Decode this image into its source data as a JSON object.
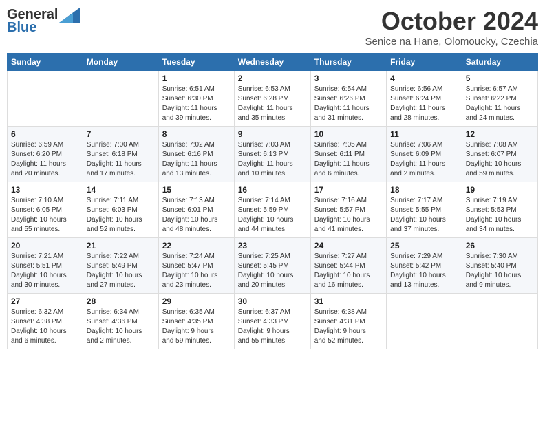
{
  "header": {
    "logo_general": "General",
    "logo_blue": "Blue",
    "title": "October 2024",
    "location": "Senice na Hane, Olomoucky, Czechia"
  },
  "weekdays": [
    "Sunday",
    "Monday",
    "Tuesday",
    "Wednesday",
    "Thursday",
    "Friday",
    "Saturday"
  ],
  "weeks": [
    [
      {
        "day": "",
        "detail": ""
      },
      {
        "day": "",
        "detail": ""
      },
      {
        "day": "1",
        "detail": "Sunrise: 6:51 AM\nSunset: 6:30 PM\nDaylight: 11 hours\nand 39 minutes."
      },
      {
        "day": "2",
        "detail": "Sunrise: 6:53 AM\nSunset: 6:28 PM\nDaylight: 11 hours\nand 35 minutes."
      },
      {
        "day": "3",
        "detail": "Sunrise: 6:54 AM\nSunset: 6:26 PM\nDaylight: 11 hours\nand 31 minutes."
      },
      {
        "day": "4",
        "detail": "Sunrise: 6:56 AM\nSunset: 6:24 PM\nDaylight: 11 hours\nand 28 minutes."
      },
      {
        "day": "5",
        "detail": "Sunrise: 6:57 AM\nSunset: 6:22 PM\nDaylight: 11 hours\nand 24 minutes."
      }
    ],
    [
      {
        "day": "6",
        "detail": "Sunrise: 6:59 AM\nSunset: 6:20 PM\nDaylight: 11 hours\nand 20 minutes."
      },
      {
        "day": "7",
        "detail": "Sunrise: 7:00 AM\nSunset: 6:18 PM\nDaylight: 11 hours\nand 17 minutes."
      },
      {
        "day": "8",
        "detail": "Sunrise: 7:02 AM\nSunset: 6:16 PM\nDaylight: 11 hours\nand 13 minutes."
      },
      {
        "day": "9",
        "detail": "Sunrise: 7:03 AM\nSunset: 6:13 PM\nDaylight: 11 hours\nand 10 minutes."
      },
      {
        "day": "10",
        "detail": "Sunrise: 7:05 AM\nSunset: 6:11 PM\nDaylight: 11 hours\nand 6 minutes."
      },
      {
        "day": "11",
        "detail": "Sunrise: 7:06 AM\nSunset: 6:09 PM\nDaylight: 11 hours\nand 2 minutes."
      },
      {
        "day": "12",
        "detail": "Sunrise: 7:08 AM\nSunset: 6:07 PM\nDaylight: 10 hours\nand 59 minutes."
      }
    ],
    [
      {
        "day": "13",
        "detail": "Sunrise: 7:10 AM\nSunset: 6:05 PM\nDaylight: 10 hours\nand 55 minutes."
      },
      {
        "day": "14",
        "detail": "Sunrise: 7:11 AM\nSunset: 6:03 PM\nDaylight: 10 hours\nand 52 minutes."
      },
      {
        "day": "15",
        "detail": "Sunrise: 7:13 AM\nSunset: 6:01 PM\nDaylight: 10 hours\nand 48 minutes."
      },
      {
        "day": "16",
        "detail": "Sunrise: 7:14 AM\nSunset: 5:59 PM\nDaylight: 10 hours\nand 44 minutes."
      },
      {
        "day": "17",
        "detail": "Sunrise: 7:16 AM\nSunset: 5:57 PM\nDaylight: 10 hours\nand 41 minutes."
      },
      {
        "day": "18",
        "detail": "Sunrise: 7:17 AM\nSunset: 5:55 PM\nDaylight: 10 hours\nand 37 minutes."
      },
      {
        "day": "19",
        "detail": "Sunrise: 7:19 AM\nSunset: 5:53 PM\nDaylight: 10 hours\nand 34 minutes."
      }
    ],
    [
      {
        "day": "20",
        "detail": "Sunrise: 7:21 AM\nSunset: 5:51 PM\nDaylight: 10 hours\nand 30 minutes."
      },
      {
        "day": "21",
        "detail": "Sunrise: 7:22 AM\nSunset: 5:49 PM\nDaylight: 10 hours\nand 27 minutes."
      },
      {
        "day": "22",
        "detail": "Sunrise: 7:24 AM\nSunset: 5:47 PM\nDaylight: 10 hours\nand 23 minutes."
      },
      {
        "day": "23",
        "detail": "Sunrise: 7:25 AM\nSunset: 5:45 PM\nDaylight: 10 hours\nand 20 minutes."
      },
      {
        "day": "24",
        "detail": "Sunrise: 7:27 AM\nSunset: 5:44 PM\nDaylight: 10 hours\nand 16 minutes."
      },
      {
        "day": "25",
        "detail": "Sunrise: 7:29 AM\nSunset: 5:42 PM\nDaylight: 10 hours\nand 13 minutes."
      },
      {
        "day": "26",
        "detail": "Sunrise: 7:30 AM\nSunset: 5:40 PM\nDaylight: 10 hours\nand 9 minutes."
      }
    ],
    [
      {
        "day": "27",
        "detail": "Sunrise: 6:32 AM\nSunset: 4:38 PM\nDaylight: 10 hours\nand 6 minutes."
      },
      {
        "day": "28",
        "detail": "Sunrise: 6:34 AM\nSunset: 4:36 PM\nDaylight: 10 hours\nand 2 minutes."
      },
      {
        "day": "29",
        "detail": "Sunrise: 6:35 AM\nSunset: 4:35 PM\nDaylight: 9 hours\nand 59 minutes."
      },
      {
        "day": "30",
        "detail": "Sunrise: 6:37 AM\nSunset: 4:33 PM\nDaylight: 9 hours\nand 55 minutes."
      },
      {
        "day": "31",
        "detail": "Sunrise: 6:38 AM\nSunset: 4:31 PM\nDaylight: 9 hours\nand 52 minutes."
      },
      {
        "day": "",
        "detail": ""
      },
      {
        "day": "",
        "detail": ""
      }
    ]
  ]
}
